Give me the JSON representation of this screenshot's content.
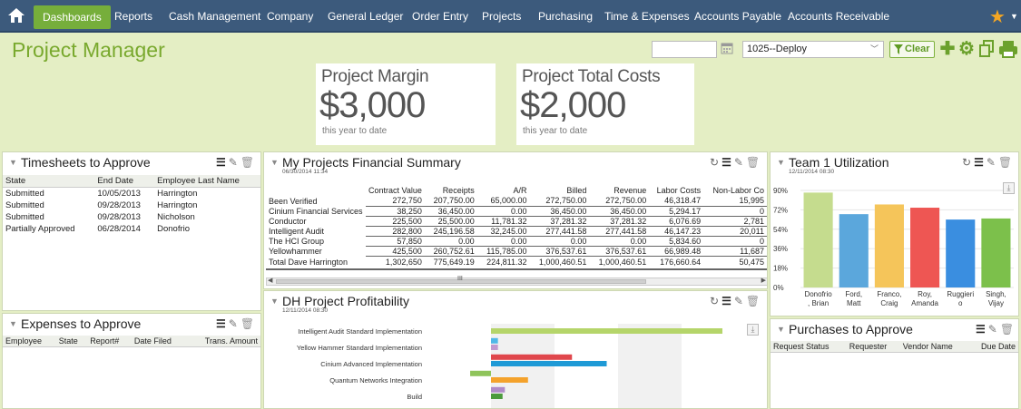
{
  "nav": {
    "items": [
      {
        "label": "Dashboards",
        "active": true
      },
      {
        "label": "Reports"
      },
      {
        "label": "Cash Management"
      },
      {
        "label": "Company"
      },
      {
        "label": "General Ledger"
      },
      {
        "label": "Order Entry"
      },
      {
        "label": "Projects"
      },
      {
        "label": "Purchasing"
      },
      {
        "label": "Time & Expenses"
      },
      {
        "label": "Accounts Payable"
      },
      {
        "label": "Accounts Receivable"
      }
    ]
  },
  "header": {
    "title": "Project Manager",
    "date_value": "",
    "select_value": "1025--Deploy",
    "clear_label": "Clear"
  },
  "kpis": [
    {
      "title": "Project Margin",
      "value": "$3,000",
      "subtitle": "this year to date"
    },
    {
      "title": "Project Total Costs",
      "value": "$2,000",
      "subtitle": "this year to date"
    }
  ],
  "timesheets": {
    "title": "Timesheets to Approve",
    "columns": [
      "State",
      "End Date",
      "Employee Last Name"
    ],
    "rows": [
      [
        "Submitted",
        "10/05/2013",
        "Harrington"
      ],
      [
        "Submitted",
        "09/28/2013",
        "Harrington"
      ],
      [
        "Submitted",
        "09/28/2013",
        "Nicholson"
      ],
      [
        "Partially Approved",
        "06/28/2014",
        "Donofrio"
      ]
    ]
  },
  "expenses": {
    "title": "Expenses to Approve",
    "columns": [
      "Employee",
      "State",
      "Report#",
      "Date Filed",
      "Trans. Amount"
    ]
  },
  "financial": {
    "title": "My Projects Financial Summary",
    "date": "06/30/2014 11:34",
    "columns": [
      "",
      "Contract Value",
      "Receipts",
      "A/R",
      "Billed",
      "Revenue",
      "Labor Costs",
      "Non-Labor Co"
    ],
    "rows": [
      [
        "Been Verified",
        "272,750",
        "207,750.00",
        "65,000.00",
        "272,750.00",
        "272,750.00",
        "46,318.47",
        "15,995"
      ],
      [
        "Cinium Financial Services",
        "38,250",
        "36,450.00",
        "0.00",
        "36,450.00",
        "36,450.00",
        "5,294.17",
        "0"
      ],
      [
        "Conductor",
        "225,500",
        "25,500.00",
        "11,781.32",
        "37,281.32",
        "37,281.32",
        "6,076.69",
        "2,781"
      ],
      [
        "Intelligent Audit",
        "282,800",
        "245,196.58",
        "32,245.00",
        "277,441.58",
        "277,441.58",
        "46,147.23",
        "20,011"
      ],
      [
        "The HCI Group",
        "57,850",
        "0.00",
        "0.00",
        "0.00",
        "0.00",
        "5,834.60",
        "0"
      ],
      [
        "Yellowhammer",
        "425,500",
        "260,752.61",
        "115,785.00",
        "376,537.61",
        "376,537.61",
        "66,989.48",
        "11,687"
      ]
    ],
    "total": [
      "Total Dave Harrington",
      "1,302,650",
      "775,649.19",
      "224,811.32",
      "1,000,460.51",
      "1,000,460.51",
      "176,660.64",
      "50,475"
    ],
    "scroll_marker": "III"
  },
  "profitability": {
    "title": "DH Project Profitability",
    "date": "12/11/2014 08:30"
  },
  "chart_data": [
    {
      "type": "bar",
      "title": "Team 1 Utilization",
      "categories": [
        "Donofrio, Brian",
        "Ford, Matt",
        "Franco, Craig",
        "Roy, Amanda",
        "Ruggiero",
        "Singh, Vijay"
      ],
      "tick_labels": [
        [
          "Donofrio",
          ", Brian"
        ],
        [
          "Ford,",
          "Matt"
        ],
        [
          "Franco,",
          "Craig"
        ],
        [
          "Roy,",
          "Amanda"
        ],
        [
          "Ruggieri",
          "o"
        ],
        [
          "Singh,",
          "Vijay"
        ]
      ],
      "values": [
        88,
        68,
        77,
        74,
        63,
        64
      ],
      "colors": [
        "#c5dc8e",
        "#5ba7dc",
        "#f5c55a",
        "#ee5653",
        "#3a8ee0",
        "#7cc04b"
      ],
      "ylim": [
        0,
        90
      ],
      "yticks": [
        "0%",
        "18%",
        "36%",
        "54%",
        "72%",
        "90%"
      ],
      "date": "12/11/2014 08:30"
    },
    {
      "type": "bar",
      "orientation": "horizontal",
      "title": "DH Project Profitability",
      "categories": [
        "Intelligent Audit Standard Implementation",
        "Yellow Hammer Standard Implementation",
        "Cinium Advanced Implementation",
        "Quantum Networks Integration",
        "Build"
      ],
      "bars": [
        {
          "row": 0,
          "offset": 0,
          "value": 100,
          "color": "#b5d56a"
        },
        {
          "row": 0.6,
          "offset": 0,
          "value": 3,
          "color": "#4fb8e8"
        },
        {
          "row": 1,
          "offset": 0,
          "value": 3,
          "color": "#c19ad0"
        },
        {
          "row": 1.6,
          "offset": 0,
          "value": 35,
          "color": "#e0474c"
        },
        {
          "row": 2,
          "offset": 0,
          "value": 50,
          "color": "#1f9ad6"
        },
        {
          "row": 2.6,
          "offset": -9,
          "value": 9,
          "color": "#8fc45b"
        },
        {
          "row": 3,
          "offset": 0,
          "value": 16,
          "color": "#f4a22c"
        },
        {
          "row": 3.6,
          "offset": 0,
          "value": 6,
          "color": "#b08bc9"
        },
        {
          "row": 4,
          "offset": 0,
          "value": 5,
          "color": "#4c9a3e"
        }
      ]
    }
  ],
  "purchases": {
    "title": "Purchases to Approve",
    "columns": [
      "Request Status",
      "Requester",
      "Vendor Name",
      "Due Date"
    ]
  }
}
